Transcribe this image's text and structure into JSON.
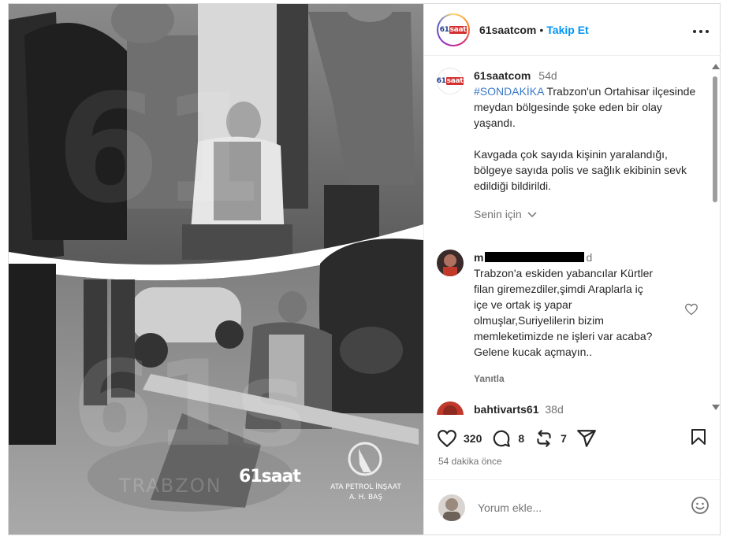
{
  "post": {
    "username": "61saatcom",
    "follow_label": "Takip Et",
    "dot": "•",
    "logo_text": "61saat",
    "caption": {
      "username": "61saatcom",
      "age": "54d",
      "hashtag": "#SONDAKİKA",
      "text1": "Trabzon'un Ortahisar ilçesinde meydan bölgesinde şoke eden bir olay yaşandı.",
      "text2": "Kavgada çok sayıda kişinin yaralandığı, bölgeye sayıda polis ve sağlık ekibinin sevk edildiği bildirildi."
    },
    "senin_icin": "Senin için",
    "comments": [
      {
        "username_visible": "m",
        "age": "d",
        "text": "Trabzon'a eskiden yabancılar Kürtler filan giremezdiler,şimdi Araplarla iç içe ve ortak iş yapar olmuşlar,Suriyelilerin bizim memleketimizde ne işleri var acaba? Gelene kucak açmayın..",
        "reply_label": "Yanıtla"
      },
      {
        "username": "bahtivarts61",
        "age": "38d"
      }
    ],
    "likes": "320",
    "comment_count": "8",
    "repost_count": "7",
    "time_ago": "54 dakika önce",
    "add_comment_placeholder": "Yorum ekle...",
    "image_overlay": {
      "brand": "61saat",
      "sponsor_line1": "ATA PETROL İNŞAAT",
      "sponsor_line2": "A. H. BAŞ",
      "watermark": "TRABZON"
    }
  },
  "colors": {
    "accent": "#0095f6",
    "hashtag": "#3a78c9",
    "muted": "#737373",
    "text": "#262626"
  }
}
